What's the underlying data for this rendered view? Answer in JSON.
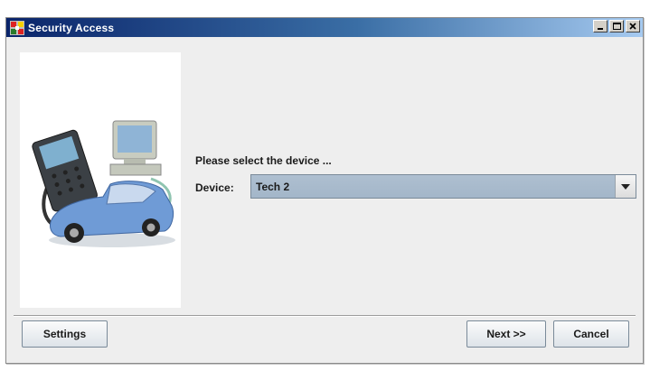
{
  "window": {
    "title": "Security Access",
    "controls": [
      "minimize",
      "maximize",
      "close"
    ]
  },
  "main": {
    "prompt": "Please select the device ...",
    "device_label": "Device:",
    "device_selected": "Tech 2"
  },
  "buttons": {
    "settings": "Settings",
    "next": "Next >>",
    "cancel": "Cancel"
  },
  "icons": {
    "app": "app-icon",
    "dropdown": "chevron-down-icon",
    "illustration": "tech2-car-computer-illustration"
  },
  "colors": {
    "titlebar_start": "#0a246a",
    "titlebar_end": "#a6caf0",
    "select_bg": "#a9bbcd",
    "window_bg": "#eeeeee"
  }
}
